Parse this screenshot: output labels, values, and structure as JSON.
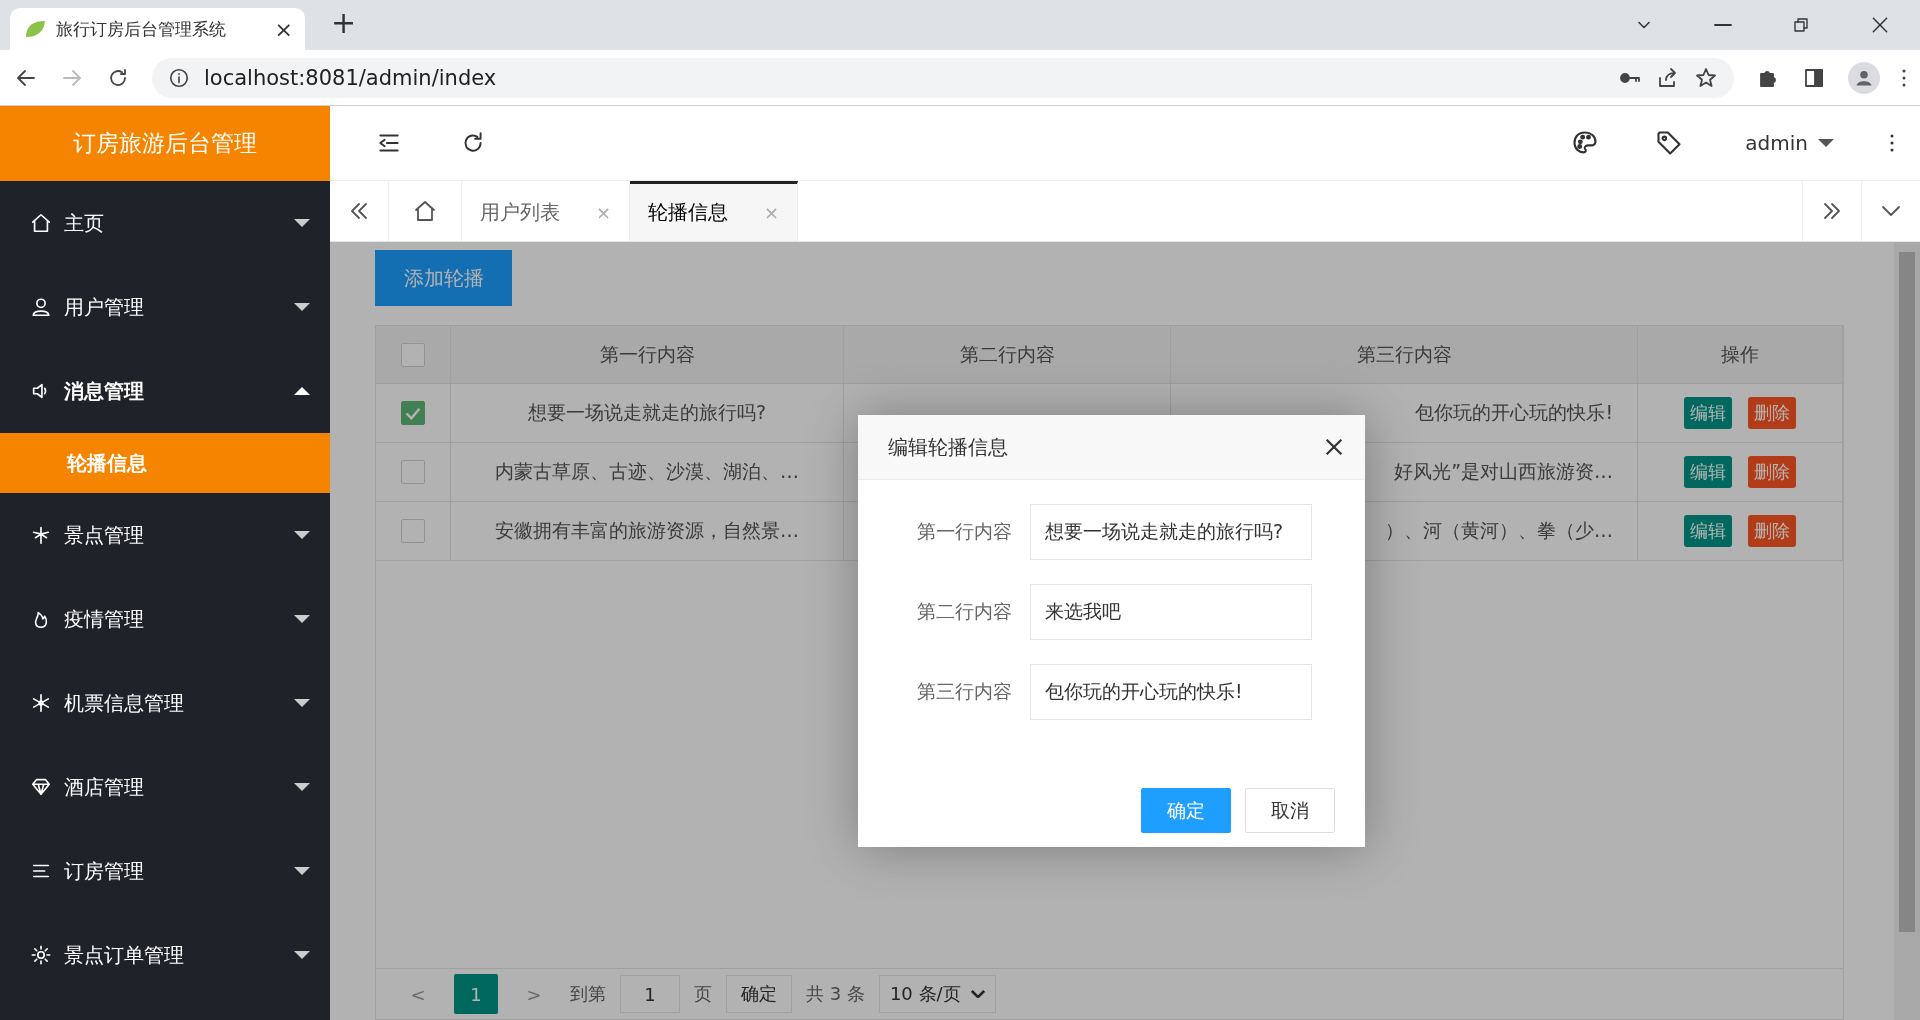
{
  "browser": {
    "tab_title": "旅行订房后台管理系统",
    "tab_close": "×",
    "new_tab": "+",
    "url": "localhost:8081/admin/index",
    "forward_disabled": true
  },
  "sidebar": {
    "logo": "订房旅游后台管理",
    "items": [
      {
        "label": "主页",
        "expanded": false
      },
      {
        "label": "用户管理",
        "expanded": false
      },
      {
        "label": "消息管理",
        "expanded": true,
        "children": [
          {
            "label": "轮播信息",
            "selected": true
          }
        ]
      },
      {
        "label": "景点管理",
        "expanded": false
      },
      {
        "label": "疫情管理",
        "expanded": false
      },
      {
        "label": "机票信息管理",
        "expanded": false
      },
      {
        "label": "酒店管理",
        "expanded": false
      },
      {
        "label": "订房管理",
        "expanded": false
      },
      {
        "label": "景点订单管理",
        "expanded": false
      }
    ]
  },
  "header": {
    "user": "admin"
  },
  "tabs": [
    {
      "label": "用户列表",
      "close": "×",
      "selected": false
    },
    {
      "label": "轮播信息",
      "close": "×",
      "selected": true
    }
  ],
  "content": {
    "add_button": "添加轮播",
    "table": {
      "all_selected": false,
      "columns": [
        "第一行内容",
        "第二行内容",
        "第三行内容",
        "操作"
      ],
      "rows": [
        {
          "selected": true,
          "column_1": "想要一场说走就走的旅行吗?",
          "column_3": "包你玩的开心玩的快乐!",
          "actions": [
            "编辑",
            "删除"
          ]
        },
        {
          "selected": false,
          "column_1": "内蒙古草原、古迹、沙漠、湖泊、…",
          "column_3": "好风光”是对山西旅游资…",
          "actions": [
            "编辑",
            "删除"
          ]
        },
        {
          "selected": false,
          "column_1": "安徽拥有丰富的旅游资源，自然景…",
          "column_3": "）、河（黄河）、拳（少…",
          "actions": [
            "编辑",
            "删除"
          ]
        }
      ]
    },
    "pagination": {
      "prev": "<",
      "pages": [
        {
          "label": "1",
          "selected": true
        }
      ],
      "next": ">",
      "goto_label": "到第",
      "goto_value": "1",
      "page_label": "页",
      "confirm": "确定",
      "total": "共 3 条",
      "page_size": "10 条/页"
    }
  },
  "dialog": {
    "title": "编辑轮播信息",
    "fields": [
      {
        "label": "第一行内容",
        "value": "想要一场说走就走的旅行吗?"
      },
      {
        "label": "第二行内容",
        "value": "来选我吧"
      },
      {
        "label": "第三行内容",
        "value": "包你玩的开心玩的快乐!"
      }
    ],
    "buttons": [
      {
        "label": "确定",
        "kind": "primary"
      },
      {
        "label": "取消",
        "kind": "default"
      }
    ]
  }
}
